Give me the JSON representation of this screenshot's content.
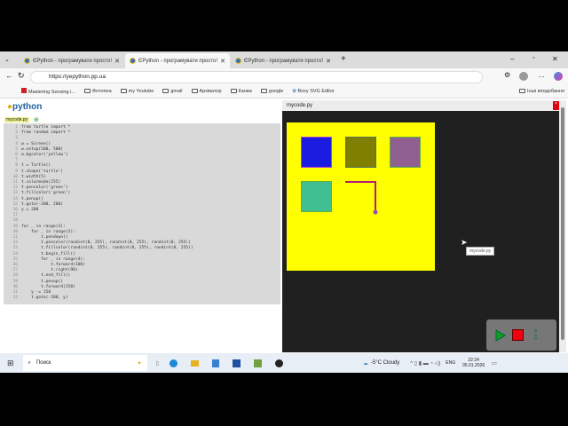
{
  "browser": {
    "tabs": [
      {
        "label": "ЄPython - програмувати просто!",
        "active": false
      },
      {
        "label": "ЄPython - програмувати просто!",
        "active": true
      },
      {
        "label": "ЄPython - програмувати просто!",
        "active": false
      }
    ],
    "url": "https://yepython.pp.ua",
    "bookmarks": [
      "Mastering Sensing i...",
      "Фотопеа",
      "my Youtube",
      "gmail",
      "Архіватор",
      "Канва",
      "google",
      "Boxy SVG Editor"
    ],
    "other_bookmarks": "Інші вподобання"
  },
  "app": {
    "logo": "python",
    "file_tab": "mycode.py",
    "code_lines": [
      "from turtle import *",
      "from random import *",
      "",
      "w = Screen()",
      "w.setup(500, 500)",
      "w.bgcolor('yellow')",
      "",
      "t = Turtle()",
      "t.shape('turtle')",
      "t.width(5)",
      "t.colormode(255)",
      "t.pencolor('green')",
      "t.fillcolor('green')",
      "t.penup()",
      "t.goto(-200, 200)",
      "y = 200",
      "",
      "",
      "for _ in range(3):",
      "    for _ in range(3):",
      "        t.pendown()",
      "        t.pencolor(randint(0, 255), randint(0, 255), randint(0, 255))",
      "        t.fillcolor(randint(0, 255), randint(0, 255), randint(0, 255))",
      "        t.begin_fill()",
      "        for _ in range(4):",
      "            t.forward(100)",
      "            t.right(90)",
      "        t.end_fill()",
      "        t.penup()",
      "        t.forward(150)",
      "    y -= 150",
      "    t.goto(-200, y)"
    ],
    "output_title": "mycode.py",
    "tooltip": "mycode.py",
    "canvas_bg": "#ffff00",
    "squares": [
      {
        "fill": "#1c1ce0",
        "stroke": "#b040d0"
      },
      {
        "fill": "#808000",
        "stroke": "#507060"
      },
      {
        "fill": "#906090",
        "stroke": "#60b040"
      },
      {
        "fill": "#40c090",
        "stroke": "#60b040"
      }
    ]
  },
  "taskbar": {
    "search": "Поиск",
    "weather": "-5°C  Cloudy",
    "lang": "ENG",
    "time": "22:24",
    "date": "05.01.2026"
  }
}
